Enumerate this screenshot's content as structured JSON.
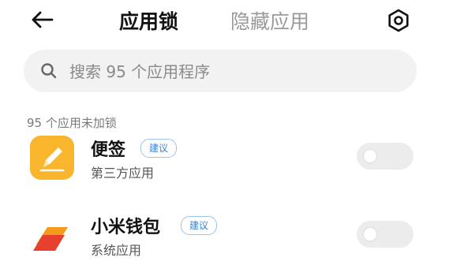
{
  "header": {
    "back_icon": "back-arrow-icon",
    "tabs": [
      {
        "label": "应用锁",
        "active": true
      },
      {
        "label": "隐藏应用",
        "active": false
      }
    ],
    "settings_icon": "settings-icon"
  },
  "search": {
    "placeholder": "搜索 95 个应用程序",
    "value": ""
  },
  "section": {
    "label": "95 个应用未加锁"
  },
  "apps": [
    {
      "name": "便签",
      "badge": "建议",
      "type": "第三方应用",
      "locked": false,
      "icon": "notes-app-icon"
    },
    {
      "name": "小米钱包",
      "badge": "建议",
      "type": "系统应用",
      "locked": false,
      "icon": "wallet-app-icon"
    }
  ],
  "colors": {
    "accent": "#3a82d3",
    "notes_icon": "#f9b52b",
    "wallet_red": "#e8402e",
    "wallet_orange": "#f59a1b",
    "toggle_off": "#ececec"
  }
}
